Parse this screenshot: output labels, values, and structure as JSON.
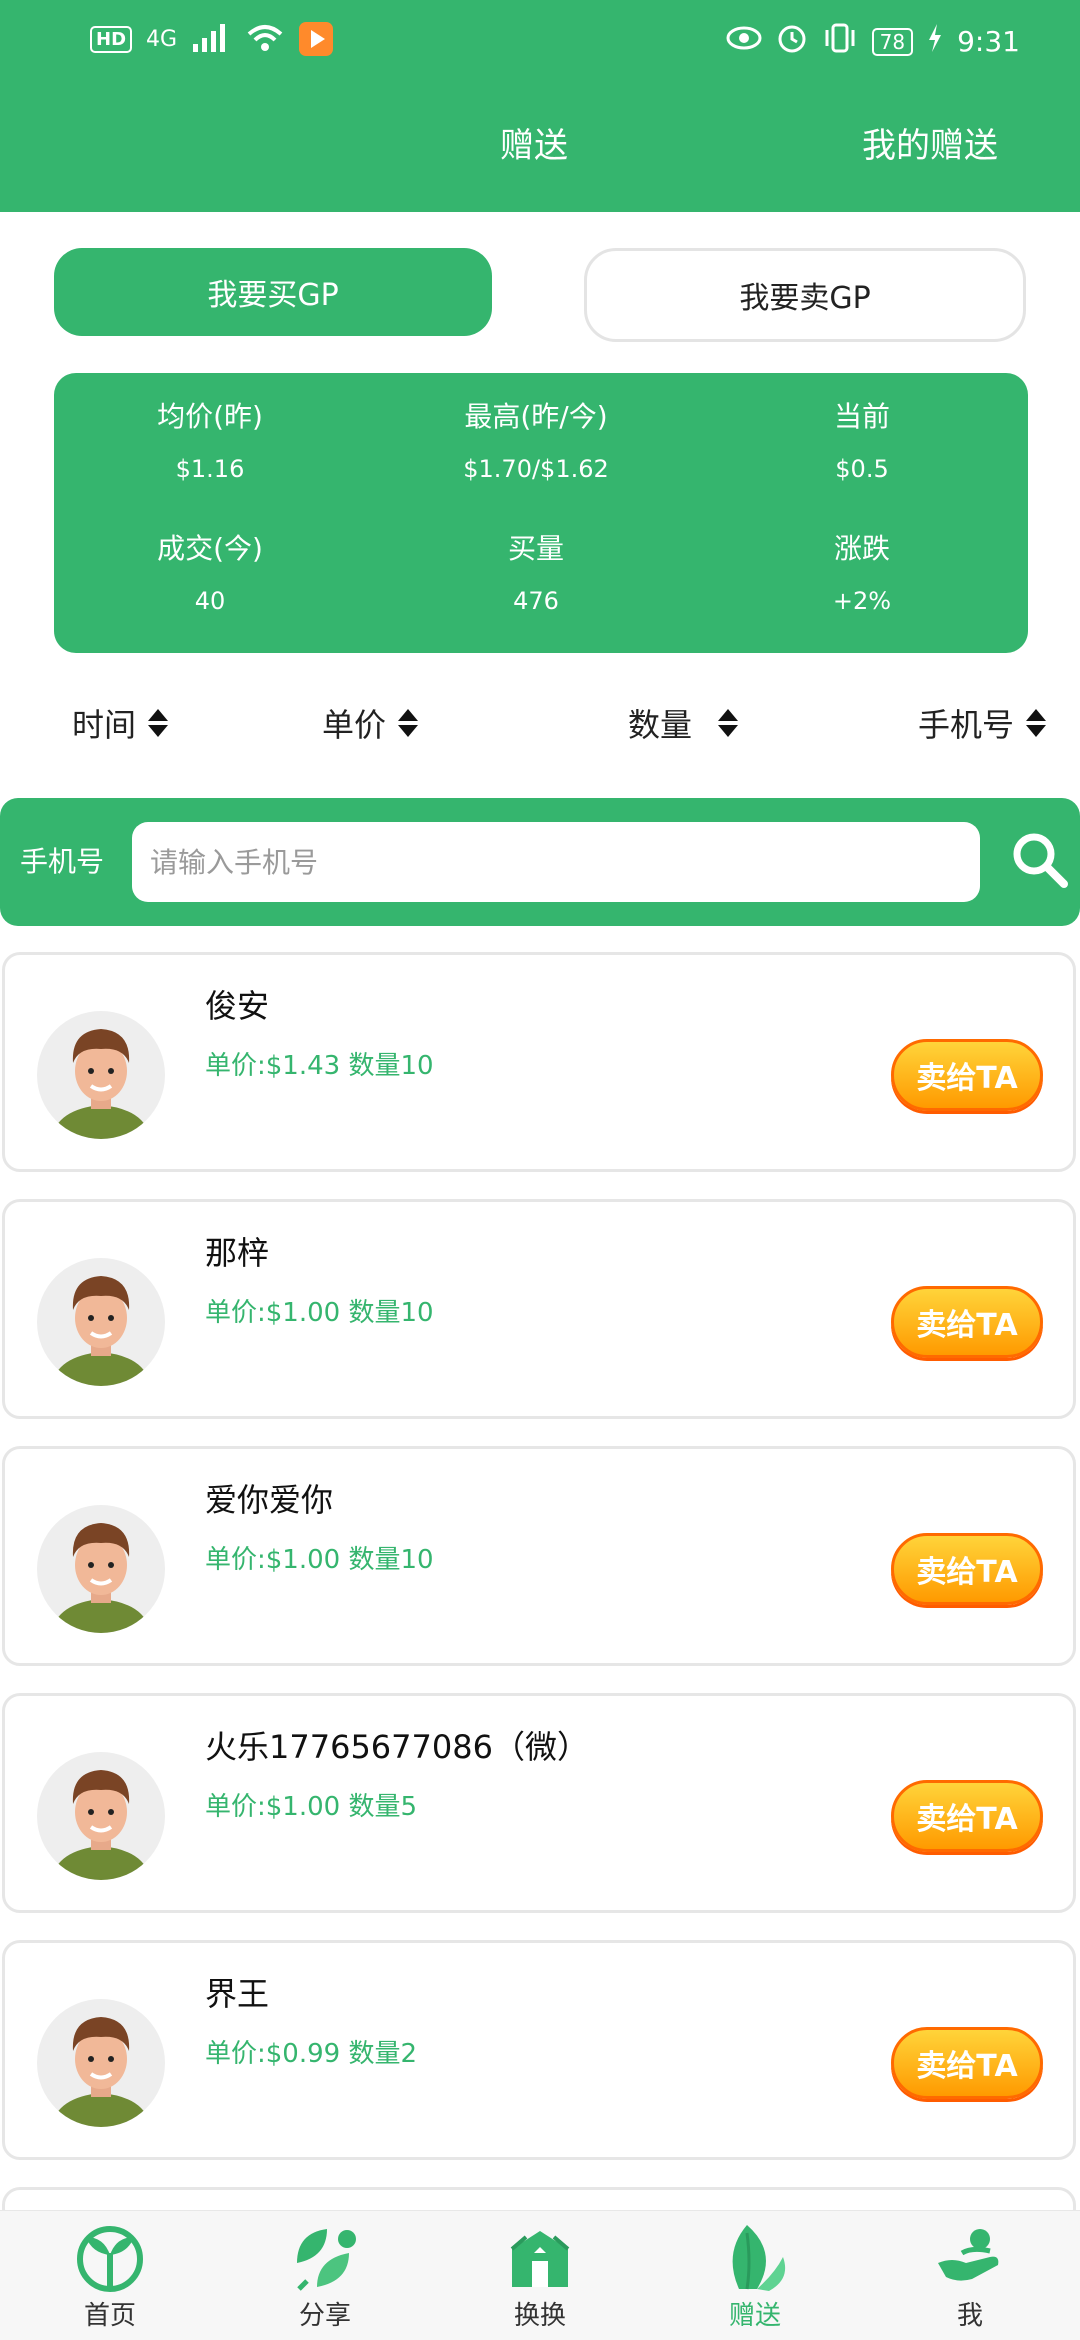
{
  "statusbar": {
    "hd": "HD",
    "network": "4G",
    "battery": "78",
    "time": "9:31"
  },
  "header": {
    "tabs": [
      {
        "label": "赠送"
      },
      {
        "label": "我的赠送"
      }
    ]
  },
  "toggle": {
    "buy_label": "我要买GP",
    "sell_label": "我要卖GP"
  },
  "stats": [
    {
      "label": "均价(昨)",
      "value": "$1.16"
    },
    {
      "label": "最高(昨/今)",
      "value": "$1.70/$1.62"
    },
    {
      "label": "当前",
      "value": "$0.5"
    },
    {
      "label": "成交(今)",
      "value": "40"
    },
    {
      "label": "买量",
      "value": "476"
    },
    {
      "label": "涨跌",
      "value": "+2%"
    }
  ],
  "sort": [
    {
      "label": "时间"
    },
    {
      "label": "单价"
    },
    {
      "label": "数量"
    },
    {
      "label": "手机号"
    }
  ],
  "search": {
    "label": "手机号",
    "placeholder": "请输入手机号"
  },
  "list": [
    {
      "name": "俊安",
      "meta": "单价:$1.43 数量10",
      "button": "卖给TA"
    },
    {
      "name": "那梓",
      "meta": "单价:$1.00 数量10",
      "button": "卖给TA"
    },
    {
      "name": "爱你爱你",
      "meta": "单价:$1.00 数量10",
      "button": "卖给TA"
    },
    {
      "name": "火乐17765677086（微）",
      "meta": "单价:$1.00 数量5",
      "button": "卖给TA"
    },
    {
      "name": "界王",
      "meta": "单价:$0.99 数量2",
      "button": "卖给TA"
    }
  ],
  "bottomnav": [
    {
      "label": "首页",
      "icon": "sprout-icon"
    },
    {
      "label": "分享",
      "icon": "share-leaf-icon"
    },
    {
      "label": "换换",
      "icon": "exchange-box-icon"
    },
    {
      "label": "赠送",
      "icon": "gift-leaf-icon"
    },
    {
      "label": "我",
      "icon": "hand-person-icon"
    }
  ],
  "colors": {
    "primary_green": "#35b56e",
    "button_orange": "#ff9a00"
  }
}
